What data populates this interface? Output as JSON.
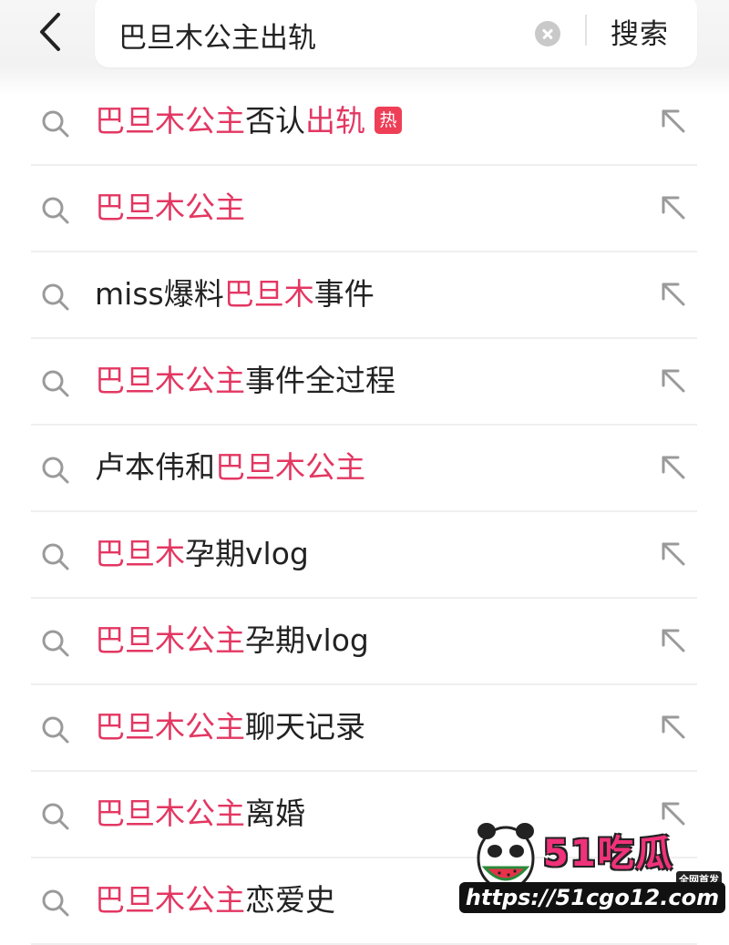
{
  "header": {
    "search": {
      "value": "巴旦木公主出轨",
      "button_label": "搜索"
    }
  },
  "suggestions": [
    {
      "parts": [
        {
          "text": "巴旦木公主",
          "hl": true
        },
        {
          "text": "否认",
          "hl": false
        },
        {
          "text": "出轨",
          "hl": true
        }
      ],
      "badge": "热"
    },
    {
      "parts": [
        {
          "text": "巴旦木公主",
          "hl": true
        }
      ]
    },
    {
      "parts": [
        {
          "text": "miss爆料",
          "hl": false
        },
        {
          "text": "巴旦木",
          "hl": true
        },
        {
          "text": "事件",
          "hl": false
        }
      ]
    },
    {
      "parts": [
        {
          "text": "巴旦木公主",
          "hl": true
        },
        {
          "text": "事件全过程",
          "hl": false
        }
      ]
    },
    {
      "parts": [
        {
          "text": "卢本伟和",
          "hl": false
        },
        {
          "text": "巴旦木公主",
          "hl": true
        }
      ]
    },
    {
      "parts": [
        {
          "text": "巴旦木",
          "hl": true
        },
        {
          "text": "孕期vlog",
          "hl": false
        }
      ]
    },
    {
      "parts": [
        {
          "text": "巴旦木公主",
          "hl": true
        },
        {
          "text": "孕期vlog",
          "hl": false
        }
      ]
    },
    {
      "parts": [
        {
          "text": "巴旦木公主",
          "hl": true
        },
        {
          "text": "聊天记录",
          "hl": false
        }
      ]
    },
    {
      "parts": [
        {
          "text": "巴旦木公主",
          "hl": true
        },
        {
          "text": "离婚",
          "hl": false
        }
      ]
    },
    {
      "parts": [
        {
          "text": "巴旦木公主",
          "hl": true
        },
        {
          "text": "恋爱史",
          "hl": false
        }
      ]
    }
  ],
  "watermark": {
    "logo_text": "51吃瓜",
    "tagline": "全网首发",
    "url": "https://51cgo12.com"
  },
  "icons": {
    "back": "chevron-left-icon",
    "clear": "clear-circle-icon",
    "row_search": "search-icon",
    "row_fill": "arrow-up-left-icon"
  },
  "colors": {
    "highlight": "#e33762",
    "hot_badge": "#ee3f57",
    "text": "#222222",
    "divider": "#efefef"
  }
}
